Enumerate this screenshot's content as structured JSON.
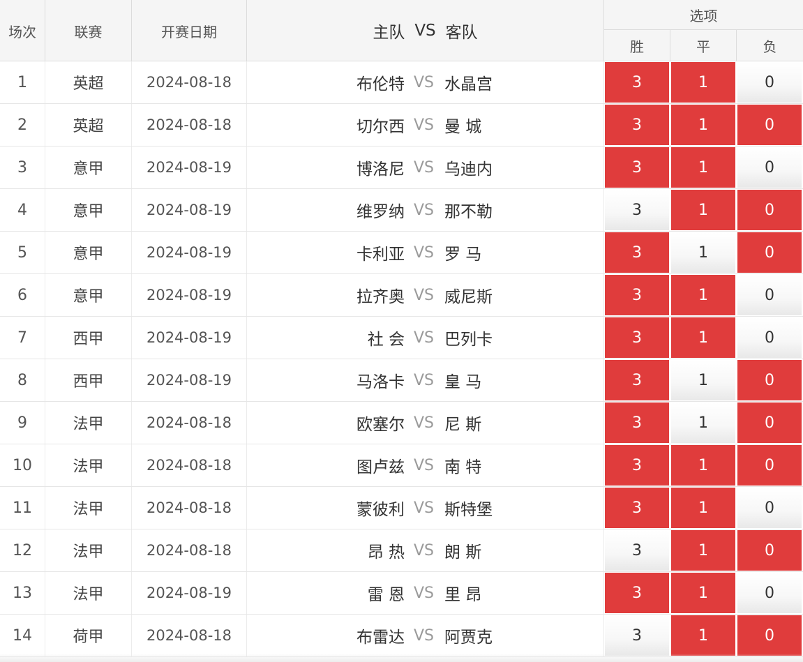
{
  "header": {
    "no": "场次",
    "league": "联赛",
    "date": "开赛日期",
    "home": "主队",
    "vs": "VS",
    "away": "客队",
    "options": "选项",
    "opt_win": "胜",
    "opt_draw": "平",
    "opt_lose": "负"
  },
  "colors": {
    "selected": "#e03c3c",
    "header_bg": "#f5f5f5"
  },
  "rows": [
    {
      "no": "1",
      "league": "英超",
      "date": "2024-08-18",
      "home": "布伦特",
      "vs": "VS",
      "away": "水晶宫",
      "opts": [
        "3",
        "1",
        "0"
      ],
      "sel": [
        true,
        true,
        false
      ]
    },
    {
      "no": "2",
      "league": "英超",
      "date": "2024-08-18",
      "home": "切尔西",
      "vs": "VS",
      "away": "曼 城",
      "opts": [
        "3",
        "1",
        "0"
      ],
      "sel": [
        true,
        true,
        true
      ]
    },
    {
      "no": "3",
      "league": "意甲",
      "date": "2024-08-19",
      "home": "博洛尼",
      "vs": "VS",
      "away": "乌迪内",
      "opts": [
        "3",
        "1",
        "0"
      ],
      "sel": [
        true,
        true,
        false
      ]
    },
    {
      "no": "4",
      "league": "意甲",
      "date": "2024-08-19",
      "home": "维罗纳",
      "vs": "VS",
      "away": "那不勒",
      "opts": [
        "3",
        "1",
        "0"
      ],
      "sel": [
        false,
        true,
        true
      ]
    },
    {
      "no": "5",
      "league": "意甲",
      "date": "2024-08-19",
      "home": "卡利亚",
      "vs": "VS",
      "away": "罗 马",
      "opts": [
        "3",
        "1",
        "0"
      ],
      "sel": [
        true,
        false,
        true
      ]
    },
    {
      "no": "6",
      "league": "意甲",
      "date": "2024-08-19",
      "home": "拉齐奥",
      "vs": "VS",
      "away": "威尼斯",
      "opts": [
        "3",
        "1",
        "0"
      ],
      "sel": [
        true,
        true,
        false
      ]
    },
    {
      "no": "7",
      "league": "西甲",
      "date": "2024-08-19",
      "home": "社 会",
      "vs": "VS",
      "away": "巴列卡",
      "opts": [
        "3",
        "1",
        "0"
      ],
      "sel": [
        true,
        true,
        false
      ]
    },
    {
      "no": "8",
      "league": "西甲",
      "date": "2024-08-19",
      "home": "马洛卡",
      "vs": "VS",
      "away": "皇 马",
      "opts": [
        "3",
        "1",
        "0"
      ],
      "sel": [
        true,
        false,
        true
      ]
    },
    {
      "no": "9",
      "league": "法甲",
      "date": "2024-08-18",
      "home": "欧塞尔",
      "vs": "VS",
      "away": "尼 斯",
      "opts": [
        "3",
        "1",
        "0"
      ],
      "sel": [
        true,
        false,
        true
      ]
    },
    {
      "no": "10",
      "league": "法甲",
      "date": "2024-08-18",
      "home": "图卢兹",
      "vs": "VS",
      "away": "南 特",
      "opts": [
        "3",
        "1",
        "0"
      ],
      "sel": [
        true,
        true,
        true
      ]
    },
    {
      "no": "11",
      "league": "法甲",
      "date": "2024-08-18",
      "home": "蒙彼利",
      "vs": "VS",
      "away": "斯特堡",
      "opts": [
        "3",
        "1",
        "0"
      ],
      "sel": [
        true,
        true,
        false
      ]
    },
    {
      "no": "12",
      "league": "法甲",
      "date": "2024-08-18",
      "home": "昂 热",
      "vs": "VS",
      "away": "朗 斯",
      "opts": [
        "3",
        "1",
        "0"
      ],
      "sel": [
        false,
        true,
        true
      ]
    },
    {
      "no": "13",
      "league": "法甲",
      "date": "2024-08-19",
      "home": "雷 恩",
      "vs": "VS",
      "away": "里 昂",
      "opts": [
        "3",
        "1",
        "0"
      ],
      "sel": [
        true,
        true,
        false
      ]
    },
    {
      "no": "14",
      "league": "荷甲",
      "date": "2024-08-18",
      "home": "布雷达",
      "vs": "VS",
      "away": "阿贾克",
      "opts": [
        "3",
        "1",
        "0"
      ],
      "sel": [
        false,
        true,
        true
      ]
    }
  ]
}
